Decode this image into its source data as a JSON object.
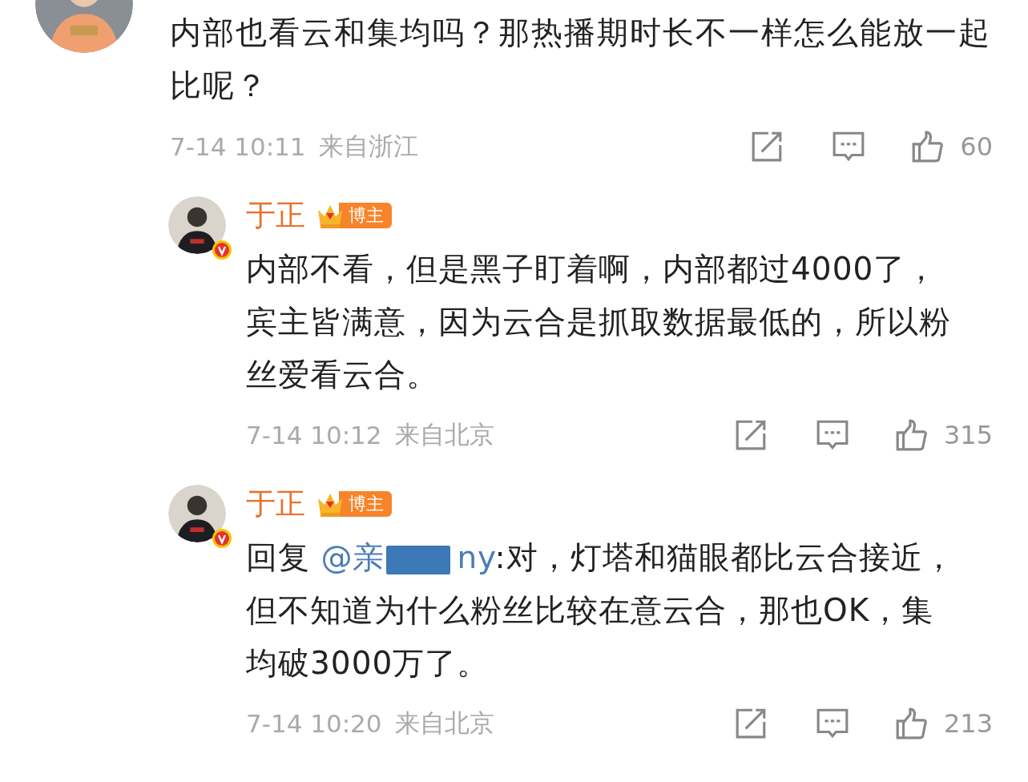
{
  "comment": {
    "text": "内部也看云和集均吗？那热播期时长不一样怎么能放一起比呢？",
    "time": "7-14 10:11",
    "location": "来自浙江",
    "likes": "60",
    "replies": [
      {
        "author": "于正",
        "badge": "博主",
        "verified": true,
        "text": "内部不看，但是黑子盯着啊，内部都过4000了，宾主皆满意，因为云合是抓取数据最低的，所以粉丝爱看云合。",
        "time": "7-14 10:12",
        "location": "来自北京",
        "likes": "315"
      },
      {
        "author": "于正",
        "badge": "博主",
        "verified": true,
        "reply_prefix": "回复",
        "mention_start": "@亲",
        "mention_end": "ny",
        "text": ":对，灯塔和猫眼都比云合接近，但不知道为什么粉丝比较在意云合，那也OK，集均破3000万了。",
        "time": "7-14 10:20",
        "location": "来自北京",
        "likes": "213"
      }
    ]
  }
}
